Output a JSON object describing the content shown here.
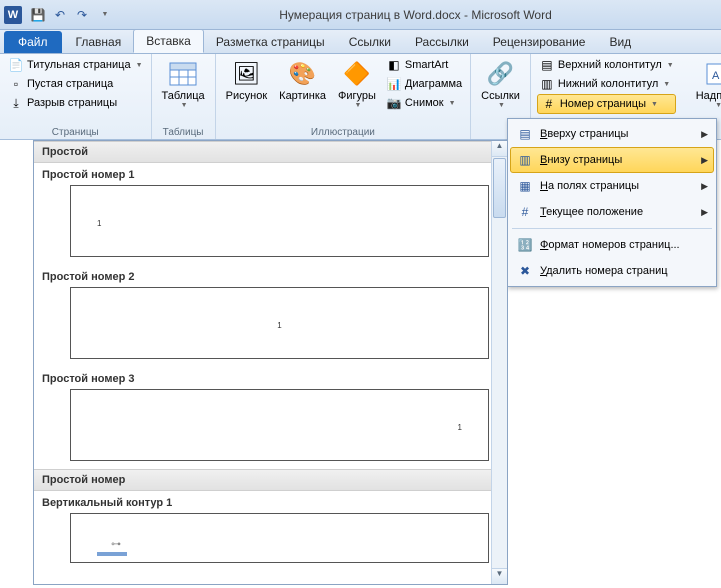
{
  "titlebar": {
    "document_title": "Нумерация страниц в Word.docx - Microsoft Word"
  },
  "tabs": {
    "file": "Файл",
    "home": "Главная",
    "insert": "Вставка",
    "layout": "Разметка страницы",
    "references": "Ссылки",
    "mailings": "Рассылки",
    "review": "Рецензирование",
    "view": "Вид"
  },
  "ribbon": {
    "pages": {
      "title_page": "Титульная страница",
      "blank_page": "Пустая страница",
      "page_break": "Разрыв страницы",
      "group": "Страницы"
    },
    "tables": {
      "table": "Таблица",
      "group": "Таблицы"
    },
    "illustrations": {
      "picture": "Рисунок",
      "clipart": "Картинка",
      "shapes": "Фигуры",
      "smartart": "SmartArt",
      "chart": "Диаграмма",
      "screenshot": "Снимок",
      "group": "Иллюстрации"
    },
    "links": {
      "links": "Ссылки",
      "group": ""
    },
    "headerfooter": {
      "header": "Верхний колонтитул",
      "footer": "Нижний колонтитул",
      "pagenum": "Номер страницы"
    },
    "text": {
      "textbox": "Надпись"
    }
  },
  "submenu": {
    "top": "Вверху страницы",
    "bottom": "Внизу страницы",
    "margins": "На полях страницы",
    "current": "Текущее положение",
    "format": "Формат номеров страниц...",
    "remove": "Удалить номера страниц"
  },
  "gallery": {
    "section1": "Простой",
    "item1": "Простой номер 1",
    "item2": "Простой номер 2",
    "item3": "Простой номер 3",
    "section2": "Простой номер",
    "item4": "Вертикальный контур 1",
    "num": "1"
  }
}
